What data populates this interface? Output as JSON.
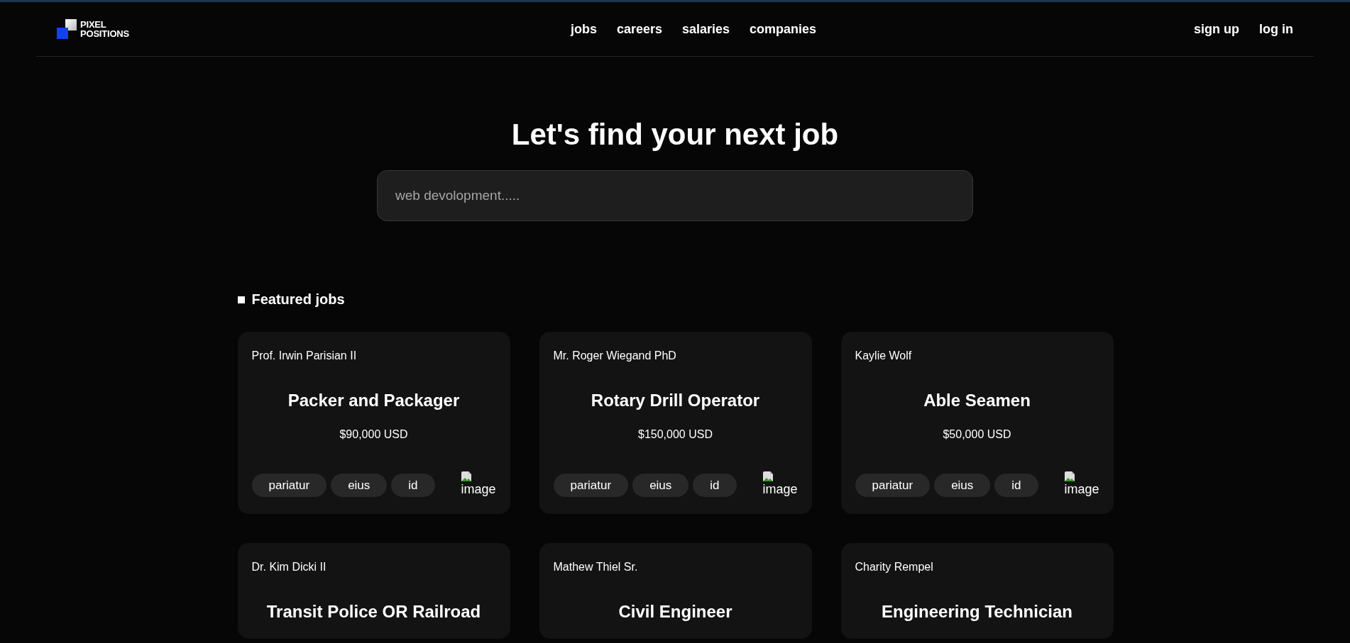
{
  "logo": {
    "line_1": "PIXEL",
    "line_2": "POSITIONS"
  },
  "nav": [
    "jobs",
    "careers",
    "salaries",
    "companies"
  ],
  "auth": [
    "sign up",
    "log in"
  ],
  "hero": {
    "title": "Let's find your next job",
    "search": {
      "placeholder": "web devolopment....."
    }
  },
  "featured": {
    "title": "Featured jobs",
    "jobs": [
      {
        "employer": "Prof. Irwin Parisian II",
        "title": "Packer and Packager",
        "salary": "$90,000 USD",
        "tags": [
          "pariatur",
          "eius",
          "id"
        ],
        "image_alt": "image"
      },
      {
        "employer": "Mr. Roger Wiegand PhD",
        "title": "Rotary Drill Operator",
        "salary": "$150,000 USD",
        "tags": [
          "pariatur",
          "eius",
          "id"
        ],
        "image_alt": "image"
      },
      {
        "employer": "Kaylie Wolf",
        "title": "Able Seamen",
        "salary": "$50,000 USD",
        "tags": [
          "pariatur",
          "eius",
          "id"
        ],
        "image_alt": "image"
      },
      {
        "employer": "Dr. Kim Dicki II",
        "title": "Transit Police OR Railroad"
      },
      {
        "employer": "Mathew Thiel Sr.",
        "title": "Civil Engineer"
      },
      {
        "employer": "Charity Rempel",
        "title": "Engineering Technician"
      }
    ]
  }
}
